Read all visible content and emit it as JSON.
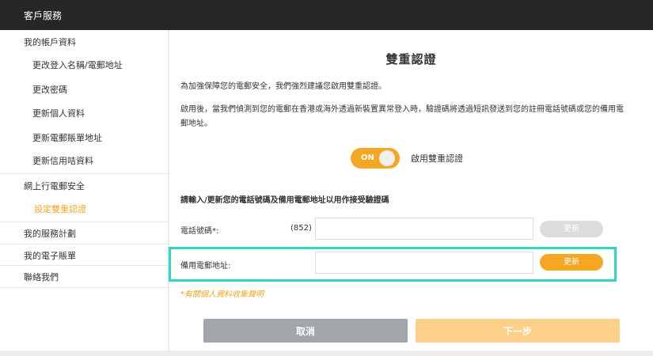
{
  "header": {
    "title": "客戶服務"
  },
  "sidebar": {
    "items": [
      {
        "label": "我的帳戶資料"
      },
      {
        "label": "更改登入名稱/電郵地址"
      },
      {
        "label": "更改密碼"
      },
      {
        "label": "更新個人資料"
      },
      {
        "label": "更新電郵賬單地址"
      },
      {
        "label": "更新信用咭資料"
      },
      {
        "label": "網上行電郵安全"
      },
      {
        "label": "設定雙重認證"
      },
      {
        "label": "我的服務計劃"
      },
      {
        "label": "我的電子賬單"
      },
      {
        "label": "聯絡我們"
      }
    ]
  },
  "main": {
    "title": "雙重認證",
    "intro": "為加強保障您的電郵安全，我們強烈建議您啟用雙重認證。",
    "description": "啟用後，當我們偵測到您的電郵在香港或海外透過新裝置異常登入時，驗證碼將透過短訊發送到您的註冊電話號碼或您的備用電郵地址。",
    "toggle": {
      "state": "ON",
      "label": "啟用雙重認證"
    },
    "section_heading": "請輸入/更新您的電話號碼及備用電郵地址以用作接受驗證碼",
    "phone": {
      "label": "電話號碼*:",
      "prefix": "(852)",
      "value": "",
      "button": "更新"
    },
    "email": {
      "label": "備用電郵地址:",
      "value": "",
      "button": "更新"
    },
    "privacy_link": "*有關個人資料收集聲明",
    "cancel_label": "取消",
    "next_label": "下一步"
  },
  "colors": {
    "accent": "#f5a623",
    "highlight": "#2ed8c3",
    "header_bg": "#262626"
  }
}
